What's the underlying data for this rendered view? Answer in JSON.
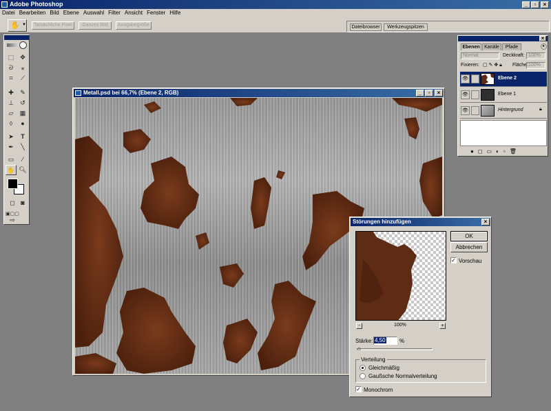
{
  "app": {
    "title": "Adobe Photoshop"
  },
  "menu": [
    "Datei",
    "Bearbeiten",
    "Bild",
    "Ebene",
    "Auswahl",
    "Filter",
    "Ansicht",
    "Fenster",
    "Hilfe"
  ],
  "options_bar": {
    "buttons": [
      "Tatsächliche Pixel",
      "Ganzes Bild",
      "Ausgabegröße"
    ],
    "well_tabs": [
      "Dateibrowser",
      "Werkzeugspitzen"
    ]
  },
  "document": {
    "title": "Metall.psd bei 66,7% (Ebene 2, RGB)"
  },
  "layers_palette": {
    "tabs": [
      "Ebenen",
      "Kanäle",
      "Pfade"
    ],
    "blend_mode": "Normal",
    "opacity_label": "Deckkraft:",
    "opacity_value": "100%",
    "lock_label": "Fixieren:",
    "fill_label": "Fläche:",
    "fill_value": "100%",
    "layers": [
      {
        "name": "Ebene 2",
        "selected": true
      },
      {
        "name": "Ebene 1",
        "selected": false
      },
      {
        "name": "Hintergrund",
        "selected": false
      }
    ]
  },
  "dialog": {
    "title": "Störungen hinzufügen",
    "ok_label": "OK",
    "cancel_label": "Abbrechen",
    "preview_label": "Vorschau",
    "preview_checked": true,
    "zoom_minus": "-",
    "zoom_value": "100%",
    "zoom_plus": "+",
    "amount_label": "Stärke:",
    "amount_value": "4,50",
    "amount_unit": "%",
    "distribution_label": "Verteilung",
    "distribution_options": [
      "Gleichmäßig",
      "Gaußsche Normalverteilung"
    ],
    "distribution_selected": 0,
    "monochrome_label": "Monochrom",
    "monochrome_checked": true
  },
  "colors": {
    "rust": "#5a2a14",
    "title_active": "#0a246a",
    "panel": "#d4d0c8"
  }
}
